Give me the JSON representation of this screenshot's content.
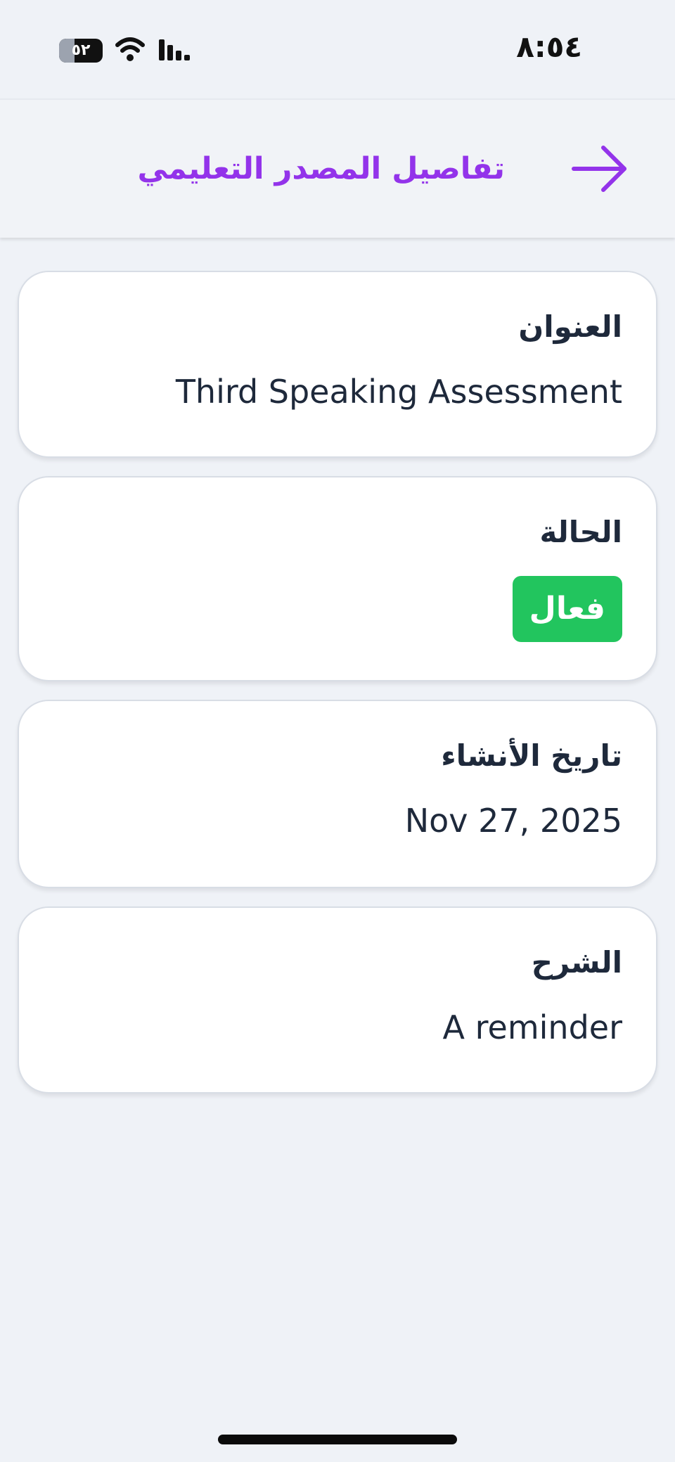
{
  "status_bar": {
    "time": "٨:٥٤",
    "battery": "٥٢"
  },
  "header": {
    "title": "تفاصيل المصدر التعليمي",
    "back_icon": "arrow-right-icon",
    "accent_color": "#9333ea"
  },
  "cards": {
    "title": {
      "label": "العنوان",
      "value": "Third Speaking Assessment"
    },
    "status": {
      "label": "الحالة",
      "badge": "فعال",
      "badge_color": "#22c55e"
    },
    "created": {
      "label": "تاريخ الأنشاء",
      "value": "Nov 27, 2025"
    },
    "description": {
      "label": "الشرح",
      "value": "A reminder"
    }
  }
}
